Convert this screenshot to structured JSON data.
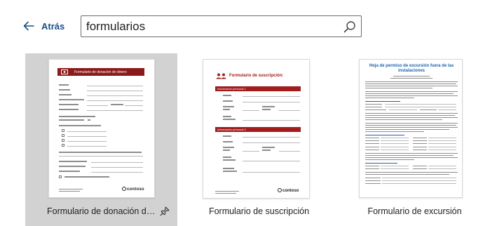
{
  "header": {
    "back_label": "Atrás",
    "search_value": "formularios"
  },
  "templates": [
    {
      "name": "Formulario de donación de...",
      "selected": true,
      "thumb_title": "Formulario de donación de dinero",
      "brand": "contoso",
      "accent": "#8b1a1a"
    },
    {
      "name": "Formulario de suscripción",
      "selected": false,
      "thumb_title": "Formulario de suscripción:",
      "section_1": "Información personal 1",
      "section_2": "Información personal 2",
      "brand": "contoso",
      "accent": "#a21c1c"
    },
    {
      "name": "Formulario de excursión",
      "selected": false,
      "thumb_title": "Hoja de permiso de excursión fuera de las instalaciones",
      "accent": "#1e63b0"
    }
  ],
  "colors": {
    "link": "#1d4e89",
    "selected_bg": "#d2d2d2"
  }
}
